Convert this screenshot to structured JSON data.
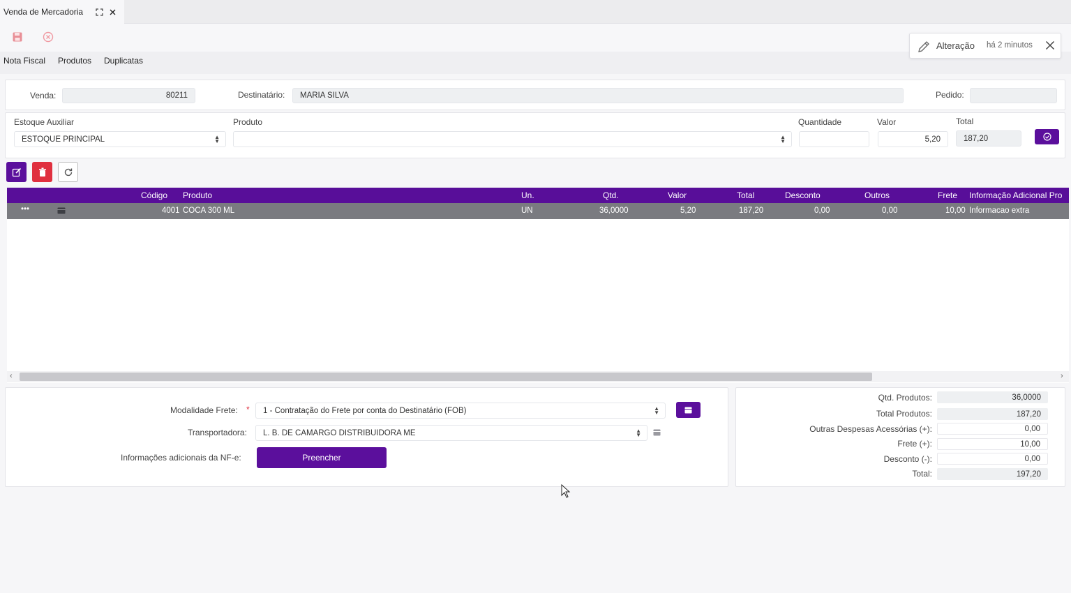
{
  "window": {
    "tab_title": "Venda de Mercadoria",
    "icons": {
      "maximize": "maximize-icon",
      "close": "close-icon",
      "save": "save-icon",
      "cancel": "cancel-icon"
    }
  },
  "menu": [
    "Nota Fiscal",
    "Produtos",
    "Duplicatas"
  ],
  "notification": {
    "title": "Alteração",
    "time": "há 2 minutos"
  },
  "header": {
    "venda_label": "Venda:",
    "venda_value": "80211",
    "destinatario_label": "Destinatário:",
    "destinatario_value": "MARIA SILVA",
    "pedido_label": "Pedido:",
    "pedido_value": ""
  },
  "item_form": {
    "estoque_label": "Estoque Auxiliar",
    "estoque_value": "ESTOQUE PRINCIPAL",
    "produto_label": "Produto",
    "produto_value": "",
    "quantidade_label": "Quantidade",
    "quantidade_value": "",
    "valor_label": "Valor",
    "valor_value": "5,20",
    "total_label": "Total",
    "total_value": "187,20"
  },
  "grid": {
    "columns": [
      "Código",
      "Produto",
      "Un.",
      "Qtd.",
      "Valor",
      "Total",
      "Desconto",
      "Outros",
      "Frete",
      "Informação Adicional Pro"
    ],
    "rows": [
      {
        "menu": "•••",
        "codigo": "4001",
        "produto": "COCA 300 ML",
        "un": "UN",
        "qtd": "36,0000",
        "valor": "5,20",
        "total": "187,20",
        "desconto": "0,00",
        "outros": "0,00",
        "frete": "10,00",
        "info": "Informacao extra"
      }
    ]
  },
  "frete": {
    "modalidade_label": "Modalidade Frete:",
    "required_mark": "*",
    "modalidade_value": "1 - Contratação do Frete por conta do Destinatário (FOB)",
    "transportadora_label": "Transportadora:",
    "transportadora_value": "L. B. DE CAMARGO DISTRIBUIDORA ME",
    "info_label": "Informações adicionais da NF-e:",
    "preencher_label": "Preencher"
  },
  "totals": [
    {
      "label": "Qtd. Produtos:",
      "value": "36,0000"
    },
    {
      "label": "Total Produtos:",
      "value": "187,20"
    },
    {
      "label": "Outras Despesas Acessórias (+):",
      "value": "0,00"
    },
    {
      "label": "Frete (+):",
      "value": "10,00"
    },
    {
      "label": "Desconto (-):",
      "value": "0,00"
    },
    {
      "label": "Total:",
      "value": "197,20"
    }
  ],
  "colors": {
    "accent": "#580e99",
    "danger": "#e0303f",
    "row_selected": "#7a7b80"
  }
}
